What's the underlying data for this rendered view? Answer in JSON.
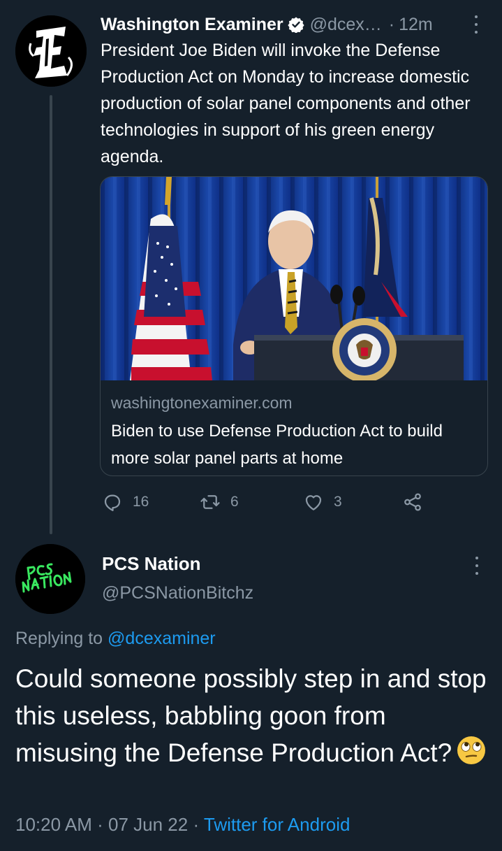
{
  "tweet": {
    "author_name": "Washington Examiner",
    "author_handle": "@dcex…",
    "separator": "·",
    "time_ago": "12m",
    "avatar_icon": "gothic-e-logo",
    "text": "President Joe Biden will invoke the Defense Production Act on Monday to increase domestic production of solar panel components and other technologies in support of his green energy agenda.",
    "card": {
      "image_icon": "press-photo",
      "domain": "washingtonexaminer.com",
      "title": "Biden to use Defense Production Act to build more solar panel parts at home"
    },
    "actions": {
      "reply_count": "16",
      "retweet_count": "6",
      "like_count": "3"
    }
  },
  "reply": {
    "author_name": "PCS Nation",
    "author_handle": "@PCSNationBitchz",
    "avatar_icon": "pcs-nation-logo",
    "replying_prefix": "Replying to",
    "replying_to": "@dcexaminer",
    "text": "Could someone possibly step in and stop this useless, babbling goon from misusing the Defense Production Act?",
    "emoji": "face-with-rolling-eyes",
    "time": "10:20 AM",
    "separator": "·",
    "date": "07 Jun 22",
    "source": "Twitter for Android"
  },
  "colors": {
    "background": "#15202b",
    "text": "#ffffff",
    "muted": "#8b98a5",
    "link": "#1d9bf0",
    "border": "#38444d"
  }
}
